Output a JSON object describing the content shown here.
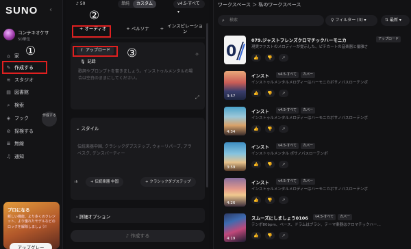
{
  "sidebar": {
    "logo": "SUNO",
    "collapse": "‹",
    "user": {
      "name": "コンテキオケサ",
      "credits": "50単位"
    },
    "items": [
      {
        "icon": "⌂",
        "label": "家"
      },
      {
        "icon": "✎",
        "label": "作成する"
      },
      {
        "icon": "≋",
        "label": "スタジオ"
      },
      {
        "icon": "▤",
        "label": "図書館"
      },
      {
        "icon": "⌕",
        "label": "検索"
      },
      {
        "icon": "◈",
        "label": "フック"
      },
      {
        "icon": "⊘",
        "label": "探検する"
      },
      {
        "icon": "≣",
        "label": "無線"
      },
      {
        "icon": "♫",
        "label": "通知"
      }
    ],
    "fab_label": "作成する",
    "promo": {
      "title": "プロになる",
      "body": "新しい機能、より多くのクレジット、より優れたモデルなどのロックを解除しましょう!"
    },
    "upgrade": "アップグレー"
  },
  "create": {
    "note_count": "50",
    "modes": [
      "単純",
      "カスタム"
    ],
    "version": "v4.5-すべて",
    "tabs": [
      "オーディオ",
      "ペルソナ",
      "インスピレーション"
    ],
    "upload": "アップロード",
    "record": "記録",
    "lyrics_placeholder": "歌詞やプロンプトを書きましょう。インストゥルメンタルの場合は空白のままにしてください。",
    "style_title": "スタイル",
    "style_text": "伝統楽器中国, クラシックダブステップ, ウォーリパーブ, アラベスク, デンスバーティー",
    "style_chips": [
      "伝統楽器 中国",
      "クラシックダブステップ"
    ],
    "advanced": "詳細オプション",
    "make": "作成する"
  },
  "workspace": {
    "breadcrumb": "ワークスペース ＞ 私のワークスペース",
    "search_placeholder": "検索",
    "filter": "フィルター (3)",
    "sort": "最新",
    "songs": [
      {
        "title": "079.ジャストフレンズクロマチックハーモニカ",
        "tags": [
          "アップロード"
        ],
        "desc": "現実ファストのメロディーが提示した、ピチカートの音楽器と優雅さ",
        "duration": ""
      },
      {
        "title": "インスト",
        "tags": [
          "v4.5-すべて",
          "カバー"
        ],
        "desc": "インストゥルメンタルメロディーはハーモニカボサノバスローテンポ",
        "duration": "3:57"
      },
      {
        "title": "インスト",
        "tags": [
          "v4.5-すべて",
          "カバー"
        ],
        "desc": "インストゥルメンタルメロディーはハーモニカボサノバスローテンポ",
        "duration": "4:34"
      },
      {
        "title": "インスト",
        "tags": [
          "v4.5-すべて",
          "カバー"
        ],
        "desc": "インストゥルメンタル ボサノバスローテンポ",
        "duration": "3:59"
      },
      {
        "title": "インスト",
        "tags": [
          "v4.5-すべて",
          "カバー"
        ],
        "desc": "インストゥルメンタルメロディーはハーモニカボサノバスローテンポ",
        "duration": "4:26"
      },
      {
        "title": "スムーズにしましょう0106",
        "tags": [
          "v4.5-すべて",
          "カバー"
        ],
        "desc": "テンポ80bpm、ベース、ドラムはブラシ、テーマ楽器はクロマチックハー…",
        "duration": "4:19"
      }
    ]
  },
  "annotations": [
    "②",
    "①",
    "③"
  ]
}
